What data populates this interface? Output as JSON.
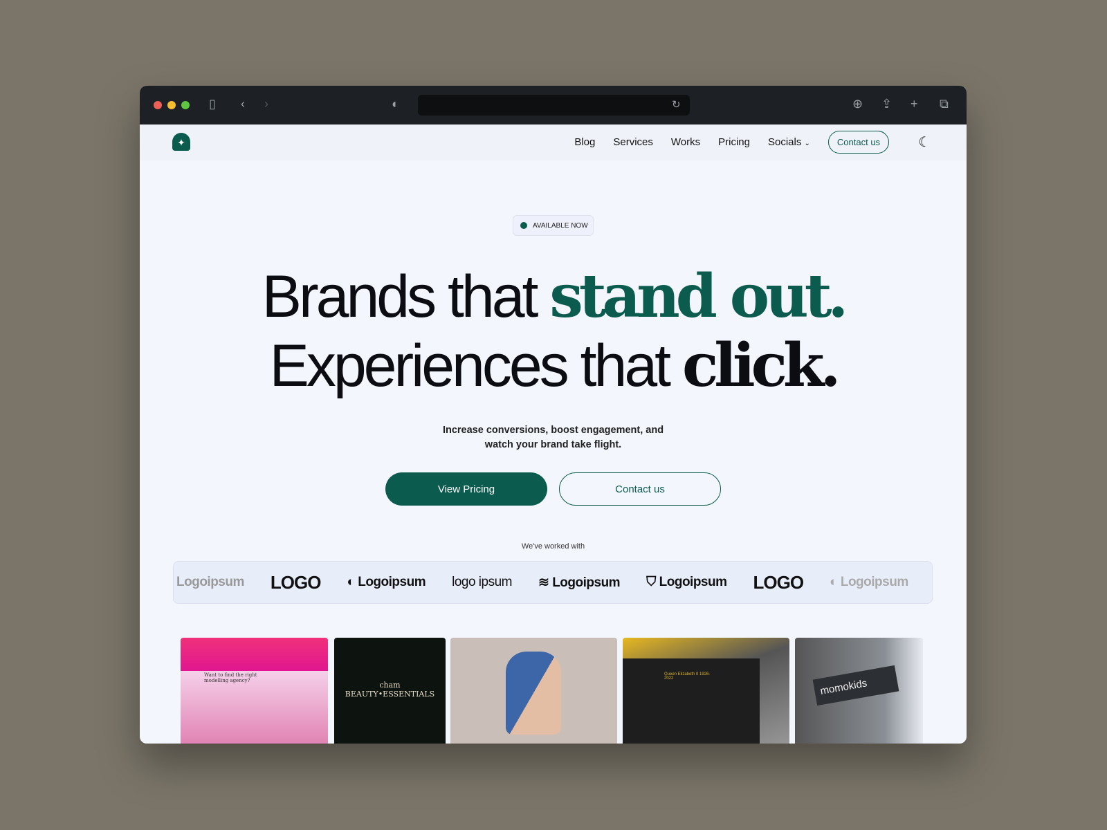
{
  "browser": {
    "icons": [
      "sidebar-icon",
      "back-icon",
      "forward-icon",
      "shield-icon",
      "reload-icon",
      "download-icon",
      "share-icon",
      "new-tab-icon",
      "tabs-icon"
    ]
  },
  "nav": {
    "links": [
      "Blog",
      "Services",
      "Works",
      "Pricing",
      "Socials"
    ],
    "contact": "Contact us"
  },
  "hero": {
    "badge": "AVAILABLE NOW",
    "line1_a": "Brands that ",
    "line1_b": "stand out.",
    "line2_a": "Experiences that ",
    "line2_b": "click.",
    "subtitle_1": "Increase conversions, boost engagement, and",
    "subtitle_2": "watch your brand take flight.",
    "primary": "View Pricing",
    "secondary": "Contact us"
  },
  "clients": {
    "label": "We've worked with",
    "logos": [
      "Logoipsum",
      "LOGO",
      "Logoipsum",
      "logo ipsum",
      "Logoipsum",
      "Logoipsum",
      "LOGO",
      "Logoipsum"
    ]
  },
  "colors": {
    "accent": "#0b5b4f"
  },
  "works": {
    "cards": [
      "Want to find the right modelling agency?",
      "cham BEAUTY•ESSENTIALS",
      "momokids bag",
      "Queen Elizabeth II 1926-2022",
      "momokids"
    ]
  }
}
